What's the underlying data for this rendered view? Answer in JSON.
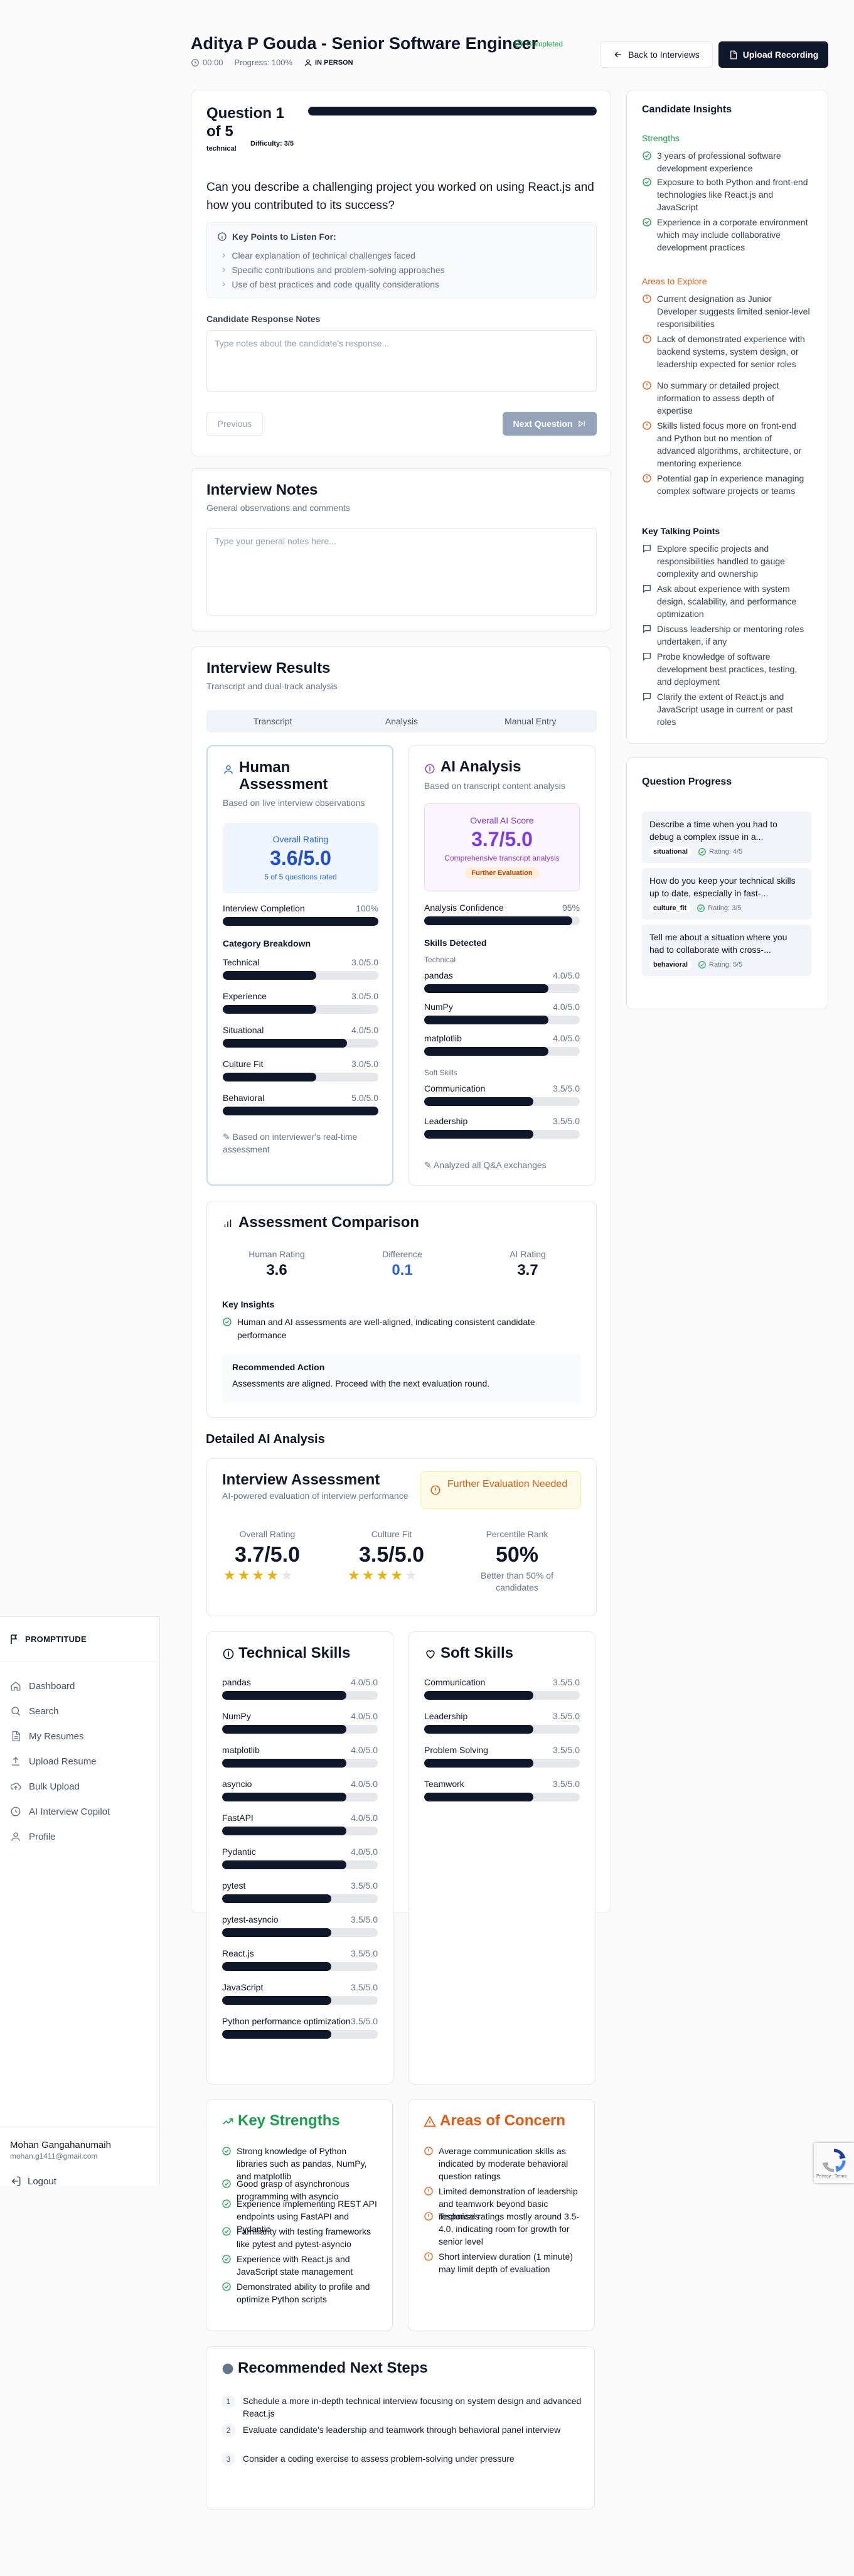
{
  "sidebar": {
    "logo": "PROMPTITUDE",
    "items": [
      {
        "label": "Dashboard",
        "icon": "home-icon"
      },
      {
        "label": "Search",
        "icon": "search-icon"
      },
      {
        "label": "My Resumes",
        "icon": "file-icon"
      },
      {
        "label": "Upload Resume",
        "icon": "upload-icon"
      },
      {
        "label": "Bulk Upload",
        "icon": "bulk-upload-icon"
      },
      {
        "label": "AI Interview Copilot",
        "icon": "copilot-icon"
      },
      {
        "label": "Profile",
        "icon": "user-icon"
      }
    ],
    "user": {
      "name": "Mohan Gangahanumaih",
      "email": "mohan.g1411@gmail.com"
    },
    "logout": "Logout"
  },
  "header": {
    "title": "Aditya P Gouda - Senior Software Engineer",
    "status": "Completed",
    "timer": "00:00",
    "progress": "Progress: 100%",
    "mode": "IN PERSON",
    "back_label": "Back to Interviews",
    "upload_label": "Upload Recording"
  },
  "question": {
    "title": "Question 1 of 5",
    "tag_type": "technical",
    "tag_difficulty": "Difficulty: 3/5",
    "text": "Can you describe a challenging project you worked on using React.js and how you contributed to its success?",
    "key_points_title": "Key Points to Listen For:",
    "key_points": [
      "Clear explanation of technical challenges faced",
      "Specific contributions and problem-solving approaches",
      "Use of best practices and code quality considerations"
    ],
    "notes_label": "Candidate Response Notes",
    "notes_placeholder": "Type notes about the candidate's response...",
    "prev_label": "Previous",
    "next_label": "Next Question"
  },
  "interview_notes": {
    "title": "Interview Notes",
    "subtitle": "General observations and comments",
    "placeholder": "Type your general notes here..."
  },
  "results": {
    "title": "Interview Results",
    "subtitle": "Transcript and dual-track analysis",
    "tabs": [
      "Transcript",
      "Analysis",
      "Manual Entry"
    ],
    "human": {
      "title": "Human Assessment",
      "subtitle": "Based on live interview observations",
      "overall_label": "Overall Rating",
      "overall_value": "3.6/5.0",
      "overall_note": "5 of 5 questions rated",
      "completion_label": "Interview Completion",
      "completion_value": "100%",
      "completion_pct": 100,
      "breakdown_label": "Category Breakdown",
      "categories": [
        {
          "name": "Technical",
          "value": "3.0/5.0",
          "pct": 60
        },
        {
          "name": "Experience",
          "value": "3.0/5.0",
          "pct": 60
        },
        {
          "name": "Situational",
          "value": "4.0/5.0",
          "pct": 80
        },
        {
          "name": "Culture Fit",
          "value": "3.0/5.0",
          "pct": 60
        },
        {
          "name": "Behavioral",
          "value": "5.0/5.0",
          "pct": 100
        }
      ],
      "footnote": "Based on interviewer's real-time assessment"
    },
    "ai": {
      "title": "AI Analysis",
      "subtitle": "Based on transcript content analysis",
      "overall_label": "Overall AI Score",
      "overall_value": "3.7/5.0",
      "overall_note": "Comprehensive transcript analysis",
      "overall_badge": "Further Evaluation",
      "confidence_label": "Analysis Confidence",
      "confidence_value": "95%",
      "confidence_pct": 95,
      "skills_label": "Skills Detected",
      "technical_label": "Technical",
      "technical": [
        {
          "name": "pandas",
          "value": "4.0/5.0",
          "pct": 80
        },
        {
          "name": "NumPy",
          "value": "4.0/5.0",
          "pct": 80
        },
        {
          "name": "matplotlib",
          "value": "4.0/5.0",
          "pct": 80
        }
      ],
      "soft_label": "Soft Skills",
      "soft": [
        {
          "name": "Communication",
          "value": "3.5/5.0",
          "pct": 70
        },
        {
          "name": "Leadership",
          "value": "3.5/5.0",
          "pct": 70
        }
      ],
      "footnote": "Analyzed all Q&A exchanges"
    }
  },
  "comparison": {
    "title": "Assessment Comparison",
    "human_label": "Human Rating",
    "human_value": "3.6",
    "diff_label": "Difference",
    "diff_value": "0.1",
    "ai_label": "AI Rating",
    "ai_value": "3.7",
    "insights_label": "Key Insights",
    "insight": "Human and AI assessments are well-aligned, indicating consistent candidate performance",
    "rec_label": "Recommended Action",
    "rec_text": "Assessments are aligned. Proceed with the next evaluation round."
  },
  "detailed": {
    "title": "Detailed AI Analysis",
    "ia_title": "Interview Assessment",
    "ia_subtitle": "AI-powered evaluation of interview performance",
    "badge": "Further Evaluation Needed",
    "overall_label": "Overall Rating",
    "overall_value": "3.7/5.0",
    "overall_stars": 4,
    "culture_label": "Culture Fit",
    "culture_value": "3.5/5.0",
    "culture_stars": 4,
    "pct_label": "Percentile Rank",
    "pct_value": "50%",
    "pct_note": "Better than 50% of candidates",
    "tech_title": "Technical Skills",
    "tech_skills": [
      {
        "name": "pandas",
        "value": "4.0/5.0",
        "pct": 80
      },
      {
        "name": "NumPy",
        "value": "4.0/5.0",
        "pct": 80
      },
      {
        "name": "matplotlib",
        "value": "4.0/5.0",
        "pct": 80
      },
      {
        "name": "asyncio",
        "value": "4.0/5.0",
        "pct": 80
      },
      {
        "name": "FastAPI",
        "value": "4.0/5.0",
        "pct": 80
      },
      {
        "name": "Pydantic",
        "value": "4.0/5.0",
        "pct": 80
      },
      {
        "name": "pytest",
        "value": "3.5/5.0",
        "pct": 70
      },
      {
        "name": "pytest-asyncio",
        "value": "3.5/5.0",
        "pct": 70
      },
      {
        "name": "React.js",
        "value": "3.5/5.0",
        "pct": 70
      },
      {
        "name": "JavaScript",
        "value": "3.5/5.0",
        "pct": 70
      },
      {
        "name": "Python performance optimization",
        "value": "3.5/5.0",
        "pct": 70
      }
    ],
    "soft_title": "Soft Skills",
    "soft_skills": [
      {
        "name": "Communication",
        "value": "3.5/5.0",
        "pct": 70
      },
      {
        "name": "Leadership",
        "value": "3.5/5.0",
        "pct": 70
      },
      {
        "name": "Problem Solving",
        "value": "3.5/5.0",
        "pct": 70
      },
      {
        "name": "Teamwork",
        "value": "3.5/5.0",
        "pct": 70
      }
    ],
    "strengths_title": "Key Strengths",
    "strengths": [
      "Strong knowledge of Python libraries such as pandas, NumPy, and matplotlib",
      "Good grasp of asynchronous programming with asyncio",
      "Experience implementing REST API endpoints using FastAPI and Pydantic",
      "Familiarity with testing frameworks like pytest and pytest-asyncio",
      "Experience with React.js and JavaScript state management",
      "Demonstrated ability to profile and optimize Python scripts"
    ],
    "concerns_title": "Areas of Concern",
    "concerns": [
      "Average communication skills as indicated by moderate behavioral question ratings",
      "Limited demonstration of leadership and teamwork beyond basic responses",
      "Technical ratings mostly around 3.5-4.0, indicating room for growth for senior level",
      "Short interview duration (1 minute) may limit depth of evaluation"
    ],
    "next_title": "Recommended Next Steps",
    "next_steps": [
      "Schedule a more in-depth technical interview focusing on system design and advanced React.js",
      "Evaluate candidate's leadership and teamwork through behavioral panel interview",
      "Consider a coding exercise to assess problem-solving under pressure"
    ]
  },
  "insights": {
    "title": "Candidate Insights",
    "strengths_label": "Strengths",
    "strengths": [
      "3 years of professional software development experience",
      "Exposure to both Python and front-end technologies like React.js and JavaScript",
      "Experience in a corporate environment which may include collaborative development practices"
    ],
    "explore_label": "Areas to Explore",
    "explore": [
      "Current designation as Junior Developer suggests limited senior-level responsibilities",
      "Lack of demonstrated experience with backend systems, system design, or leadership expected for senior roles",
      "No summary or detailed project information to assess depth of expertise",
      "Skills listed focus more on front-end and Python but no mention of advanced algorithms, architecture, or mentoring experience",
      "Potential gap in experience managing complex software projects or teams"
    ],
    "talking_label": "Key Talking Points",
    "talking": [
      "Explore specific projects and responsibilities handled to gauge complexity and ownership",
      "Ask about experience with system design, scalability, and performance optimization",
      "Discuss leadership or mentoring roles undertaken, if any",
      "Probe knowledge of software development best practices, testing, and deployment",
      "Clarify the extent of React.js and JavaScript usage in current or past roles"
    ]
  },
  "progress": {
    "title": "Question Progress",
    "items": [
      {
        "text": "Describe a time when you had to debug a complex issue in a...",
        "category": "situational",
        "rating": "Rating: 4/5"
      },
      {
        "text": "How do you keep your technical skills up to date, especially in fast-...",
        "category": "culture_fit",
        "rating": "Rating: 3/5"
      },
      {
        "text": "Tell me about a situation where you had to collaborate with cross-...",
        "category": "behavioral",
        "rating": "Rating: 5/5"
      }
    ]
  },
  "colors": {
    "primary": "#0f172a",
    "green": "#16a34a",
    "orange": "#ea580c",
    "blue": "#2563eb",
    "purple": "#7c3aed"
  }
}
